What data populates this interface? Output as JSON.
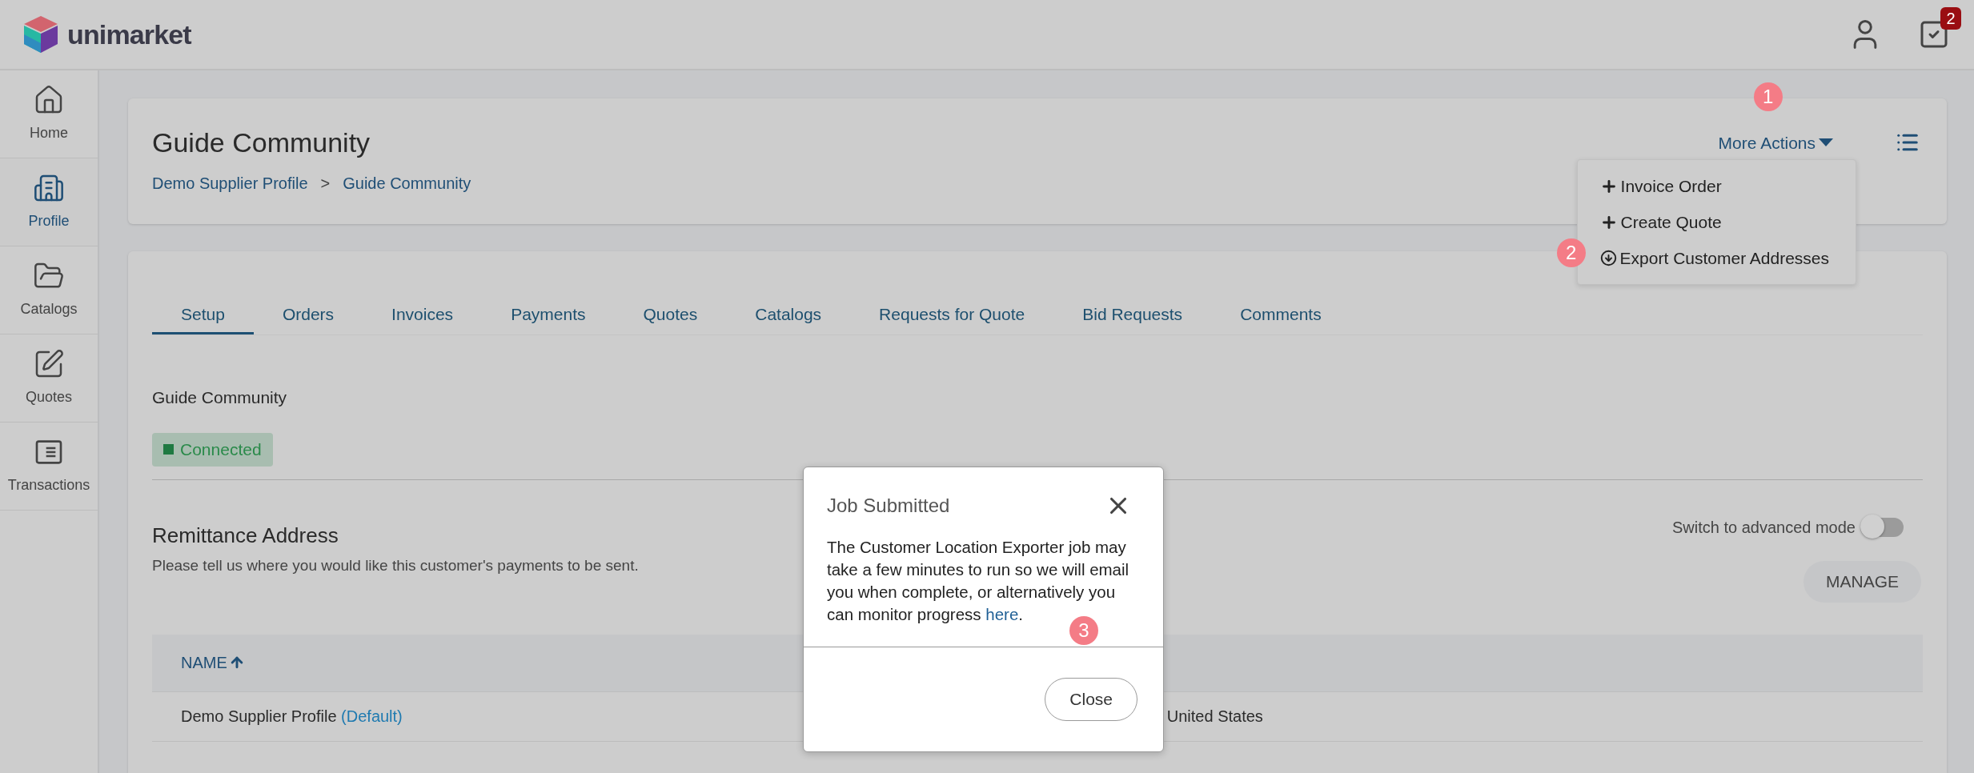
{
  "header": {
    "logo": "unimarket",
    "task_count": "2"
  },
  "sidebar": {
    "items": [
      {
        "kind": "home",
        "label": "Home",
        "selected": false
      },
      {
        "kind": "building",
        "label": "Profile",
        "selected": true
      },
      {
        "kind": "folder",
        "label": "Catalogs",
        "selected": false
      },
      {
        "kind": "edit",
        "label": "Quotes",
        "selected": false
      },
      {
        "kind": "list",
        "label": "Transactions",
        "selected": false
      }
    ]
  },
  "page": {
    "title": "Guide Community",
    "breadcrumb": [
      "Demo Supplier Profile",
      ">",
      "Guide Community"
    ],
    "more_actions": "More Actions",
    "menu": [
      {
        "kind": "add",
        "label": "Invoice Order"
      },
      {
        "kind": "add",
        "label": "Create Quote"
      },
      {
        "kind": "download",
        "label": "Export Customer Addresses"
      }
    ]
  },
  "tabs": [
    {
      "label": "Setup",
      "selected": true
    },
    {
      "label": "Orders",
      "selected": false
    },
    {
      "label": "Invoices",
      "selected": false
    },
    {
      "label": "Payments",
      "selected": false
    },
    {
      "label": "Quotes",
      "selected": false
    },
    {
      "label": "Catalogs",
      "selected": false
    },
    {
      "label": "Requests for Quote",
      "selected": false
    },
    {
      "label": "Bid Requests",
      "selected": false
    },
    {
      "label": "Comments",
      "selected": false
    }
  ],
  "setup": {
    "community": "Guide Community",
    "status": "Connected",
    "remittance": {
      "title": "Remittance Address",
      "subtitle": "Please tell us where you would like this customer's payments to be sent.",
      "advanced_label": "Switch to advanced mode",
      "advanced_on": false,
      "manage": "MANAGE"
    },
    "table": {
      "columns": [
        "NAME"
      ],
      "rows": [
        {
          "name": "Demo Supplier Profile",
          "tag": "(Default)",
          "country": "United States"
        }
      ]
    }
  },
  "dialog": {
    "title": "Job Submitted",
    "text": "The Customer Location Exporter job may take a few minutes to run so we will email you when complete, or alternatively you can monitor progress ",
    "link": "here",
    "after": ".",
    "close": "Close"
  },
  "callouts": [
    "1",
    "2",
    "3"
  ]
}
